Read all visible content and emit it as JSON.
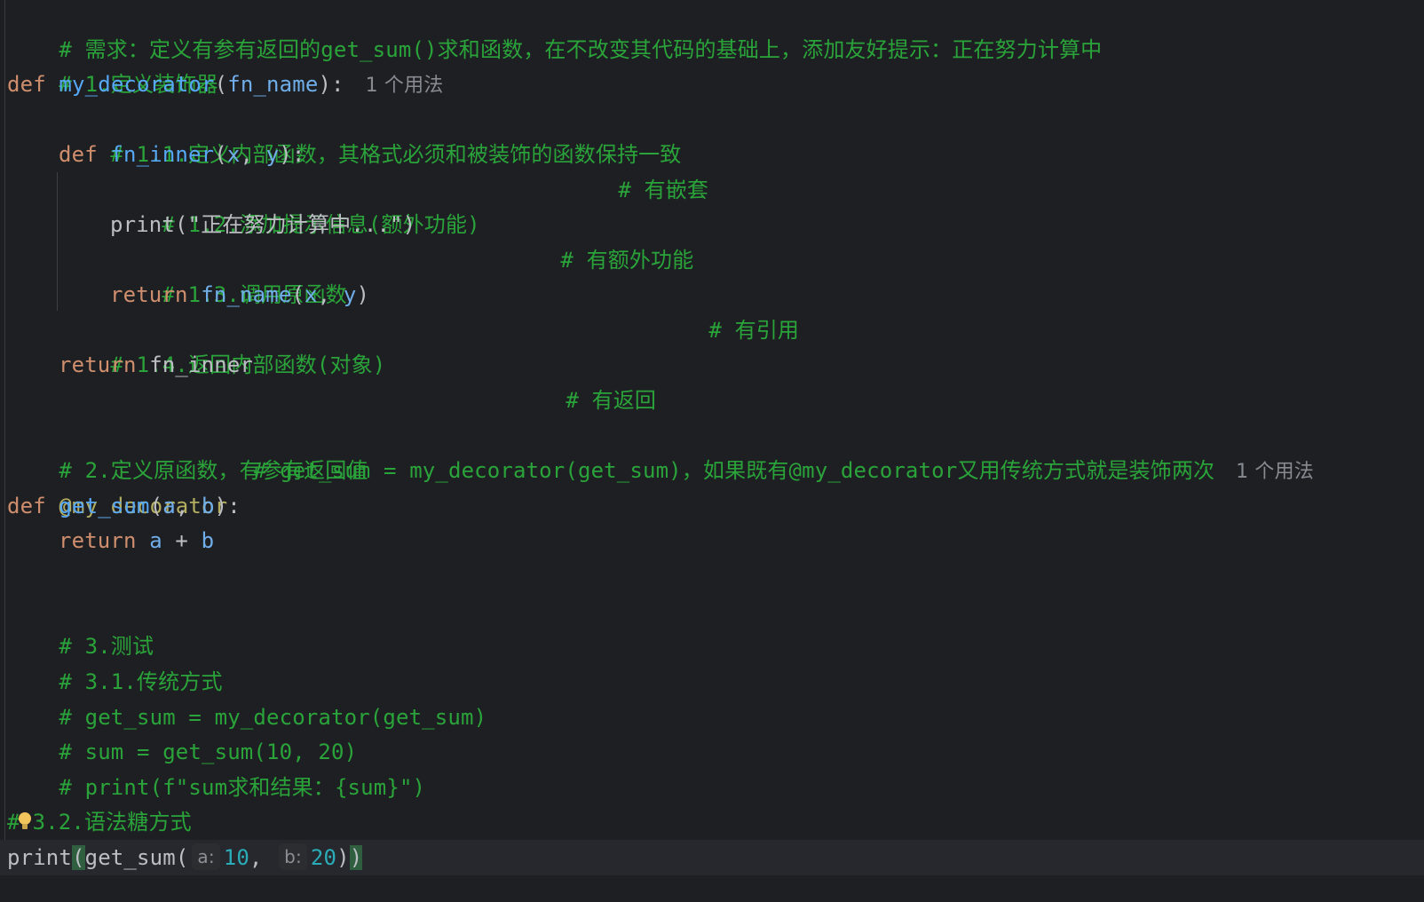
{
  "editor": {
    "lines": {
      "l1": "# 需求：定义有参有返回的get_sum()求和函数，在不改变其代码的基础上，添加友好提示：正在努力计算中",
      "l2": "# 1.定义装饰器",
      "l3_kw": "def",
      "l3_fn": "my_decorator",
      "l3_open": "(",
      "l3_param": "fn_name",
      "l3_close": "):",
      "l3_usage": "1 个用法",
      "l4": "# 1.1.定义内部函数，其格式必须和被装饰的函数保持一致",
      "l5_kw": "def",
      "l5_fn": "fn_inner",
      "l5_open": "(",
      "l5_p1": "x",
      "l5_sep": ", ",
      "l5_p2": "y",
      "l5_close": "):",
      "l5_cmt": "# 有嵌套",
      "l6": "# 1.2.添加提示信息(额外功能)",
      "l7_fn": "print",
      "l7_open": "(",
      "l7_str": "\"正在努力计算中...\"",
      "l7_close": ")",
      "l7_cmt": "# 有额外功能",
      "l8": "# 1.3.调用原函数",
      "l9_kw": "return",
      "l9_fn": "fn_name",
      "l9_open": "(",
      "l9_p1": "x",
      "l9_sep": ", ",
      "l9_p2": "y",
      "l9_close": ")",
      "l9_cmt": "# 有引用",
      "l10": "# 1.4.返回内部函数(对象)",
      "l11_kw": "return",
      "l11_name": "fn_inner",
      "l11_cmt": "# 有返回",
      "l13": "# 2.定义原函数，有参有返回值",
      "l14_deco": "@my_decorator",
      "l14_cmt": "# get_sum = my_decorator(get_sum)，如果既有@my_decorator又用传统方式就是装饰两次",
      "l14_usage": "1 个用法",
      "l15_kw": "def",
      "l15_fn": "get_sum",
      "l15_open": "(",
      "l15_p1": "a",
      "l15_sep": ", ",
      "l15_p2": "b",
      "l15_close": "):",
      "l16_kw": "return",
      "l16_a": "a",
      "l16_op": " + ",
      "l16_b": "b",
      "l18": "# 3.测试",
      "l19": "# 3.1.传统方式",
      "l20": "# get_sum = my_decorator(get_sum)",
      "l21": "# sum = get_sum(10, 20)",
      "l22": "# print(f\"sum求和结果：{sum}\")",
      "l24_hash": "#",
      "l24_rest": "3.2.语法糖方式",
      "l25_fn": "print",
      "l25_open": "(",
      "l25_fn2": "get_sum",
      "l25_open2": "(",
      "l25_hint_a": "a:",
      "l25_v1": "10",
      "l25_sep": ",",
      "l25_hint_b": "b:",
      "l25_v2": "20",
      "l25_close1": ")",
      "l25_close2": ")"
    }
  },
  "colors": {
    "background": "#1e1f22",
    "keyword": "#cf8e6d",
    "comment": "#2aa43a",
    "function": "#56a8f5",
    "number": "#2aacb8",
    "decorator": "#b3ae60"
  },
  "icons": {
    "intention": "lightbulb-icon"
  }
}
